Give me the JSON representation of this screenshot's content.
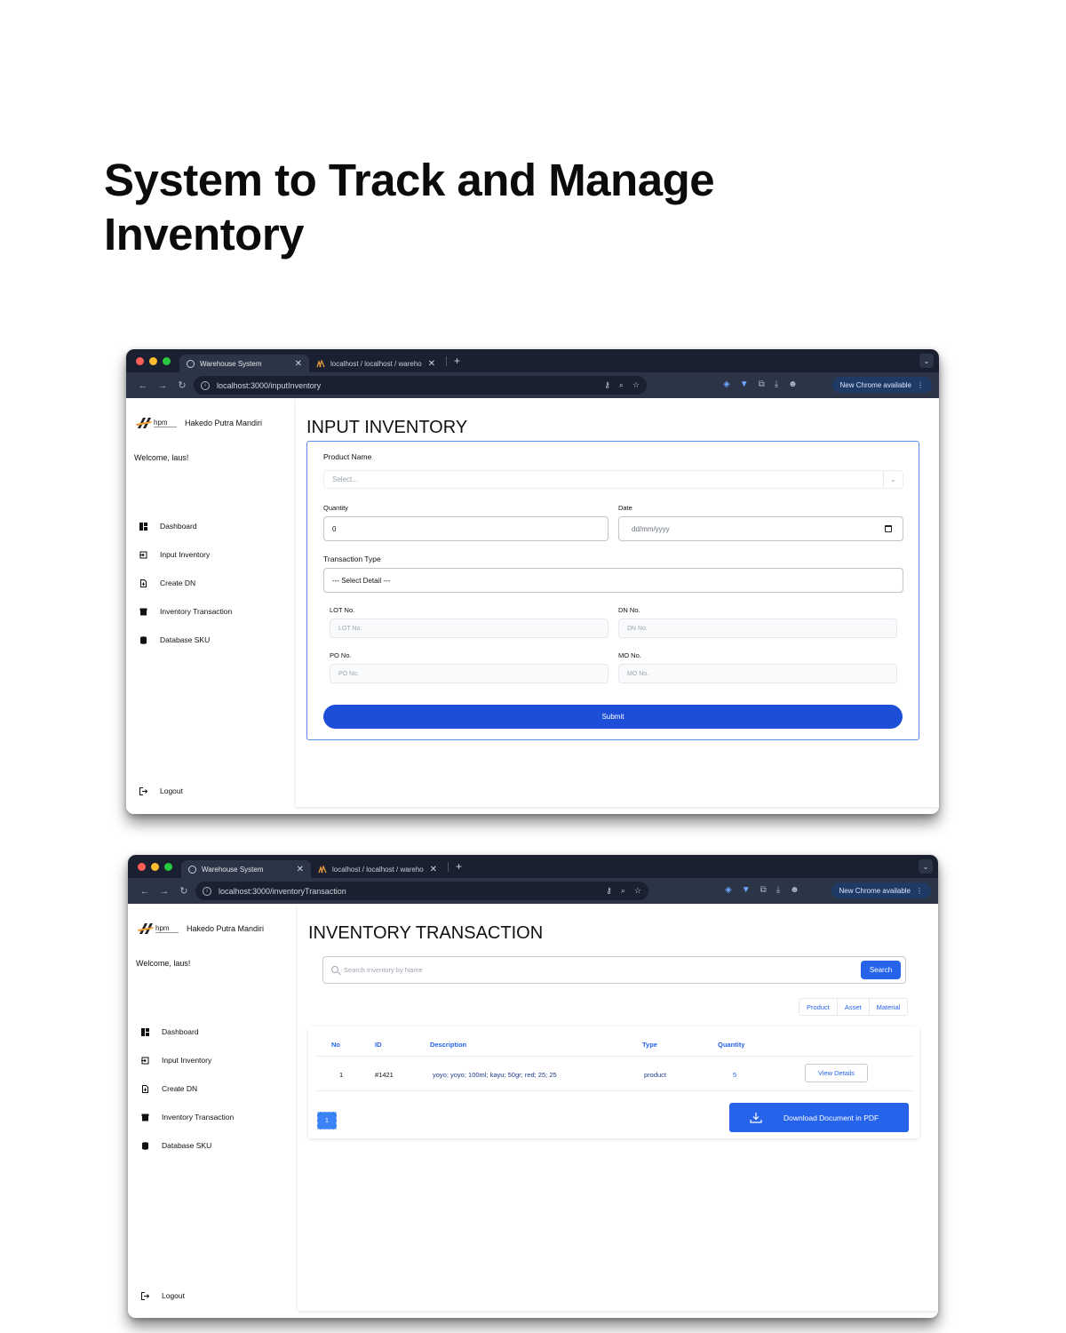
{
  "heading": {
    "line1": "System to Track and Manage",
    "line2": "Inventory"
  },
  "browser": {
    "tabs": [
      {
        "title": "Warehouse System",
        "active": true
      },
      {
        "title": "localhost / localhost / wareho",
        "active": false
      }
    ],
    "new_chrome": "New Chrome available",
    "icons": [
      "back-icon",
      "forward-icon",
      "reload-icon",
      "key-icon",
      "zoom-icon",
      "star-icon",
      "extension-icon",
      "download-icon"
    ]
  },
  "app": {
    "company": "Hakedo Putra Mandiri",
    "welcome": "Welcome, laus!",
    "nav": [
      "Dashboard",
      "Input Inventory",
      "Create DN",
      "Inventory Transaction",
      "Database SKU"
    ],
    "logout": "Logout"
  },
  "screen1": {
    "url": "localhost:3000/inputInventory",
    "title": "INPUT INVENTORY",
    "product_name_label": "Product Name",
    "product_select_placeholder": "Select...",
    "quantity_label": "Quantity",
    "quantity_value": "0",
    "date_label": "Date",
    "date_placeholder": "dd/mm/yyyy",
    "transaction_type_label": "Transaction Type",
    "transaction_type_value": "--- Select Detail ---",
    "lot_label": "LOT No.",
    "lot_placeholder": "LOT No.",
    "dn_label": "DN No.",
    "dn_placeholder": "DN No.",
    "po_label": "PO No.",
    "po_placeholder": "PO No.",
    "mo_label": "MO No.",
    "mo_placeholder": "MO No.",
    "submit": "Submit"
  },
  "screen2": {
    "url": "localhost:3000/inventoryTransaction",
    "title": "INVENTORY TRANSACTION",
    "search_placeholder": "Search Inventory by Name",
    "search_button": "Search",
    "filters": [
      "Product",
      "Asset",
      "Material"
    ],
    "columns": [
      "No",
      "ID",
      "Description",
      "Type",
      "Quantity"
    ],
    "rows": [
      {
        "no": "1",
        "id": "#1421",
        "description": "yoyo; yoyo; 100ml; kayu; 50gr; red; 25; 25",
        "type": "product",
        "quantity": "5",
        "action": "View Details"
      }
    ],
    "page": "1",
    "download": "Download Document in PDF"
  },
  "colors": {
    "accent": "#1d4ed8",
    "link": "#2563eb",
    "chrome_dark": "#1b2030",
    "chrome_bar": "#2c3447"
  }
}
